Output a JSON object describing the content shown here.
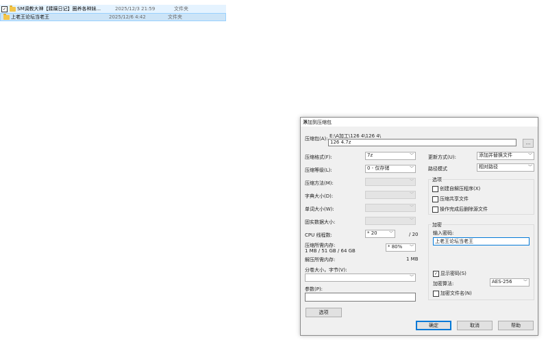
{
  "file_list": {
    "rows": [
      {
        "name": "SM调教大神【蹂躏日记】圈养各种妹...",
        "date": "2025/12/3 21:59",
        "type": "文件夹",
        "checked": true
      },
      {
        "name": "上老王论坛当老王",
        "date": "2025/12/6 4:42",
        "type": "文件夹",
        "checked": false
      }
    ]
  },
  "dialog": {
    "title": "添加到压缩包",
    "close_icon": "✕",
    "archive": {
      "label": "压缩包(A):",
      "path": "E:\\A加工\\126 4\\126 4\\",
      "name": "126 4.7z",
      "browse_label": "..."
    },
    "format": {
      "label": "压缩格式(F):",
      "value": "7z"
    },
    "level": {
      "label": "压缩等级(L):",
      "value": "0 - 仅存储"
    },
    "method": {
      "label": "压缩方法(M):",
      "value": ""
    },
    "dict": {
      "label": "字典大小(D):",
      "value": ""
    },
    "word": {
      "label": "单词大小(W):",
      "value": ""
    },
    "solid": {
      "label": "固实数据大小:",
      "value": ""
    },
    "cpu": {
      "label": "CPU 线程数:",
      "value": "* 20",
      "max": "/ 20"
    },
    "mem_compress": {
      "label": "压缩所需内存:",
      "detail": "1 MB / 51 GB / 64 GB",
      "value": "* 80%"
    },
    "mem_decompress": {
      "label": "解压所需内存:",
      "value": "1 MB"
    },
    "split": {
      "label": "分卷大小，字节(V):",
      "value": ""
    },
    "params": {
      "label": "参数(P):",
      "value": ""
    },
    "options_button": "选项",
    "update": {
      "label": "更新方式(U):",
      "value": "添加并替换文件"
    },
    "path_mode": {
      "label": "路径模式",
      "value": "相对路径"
    },
    "options": {
      "title": "选项",
      "items": [
        {
          "label": "创建自解压程序(X)",
          "checked": false
        },
        {
          "label": "压缩共享文件",
          "checked": false
        },
        {
          "label": "操作完成后删除源文件",
          "checked": false
        }
      ]
    },
    "encryption": {
      "title": "加密",
      "password_label": "输入密码:",
      "password": "上老王论坛当老王",
      "show_password": {
        "label": "显示密码(S)",
        "checked": true
      },
      "method_label": "加密算法:",
      "method_value": "AES-256",
      "encrypt_names": {
        "label": "加密文件名(N)",
        "checked": false
      }
    },
    "buttons": {
      "ok": "确定",
      "cancel": "取消",
      "help": "帮助"
    }
  }
}
